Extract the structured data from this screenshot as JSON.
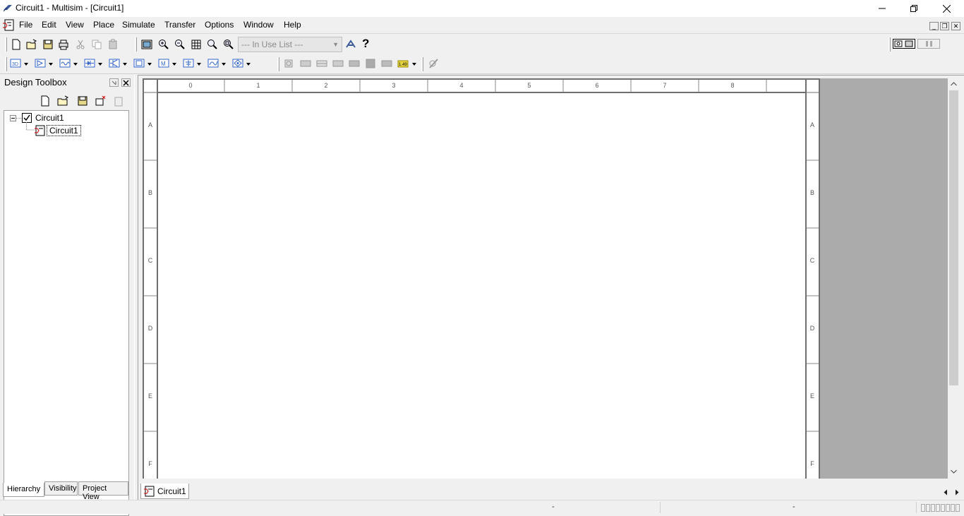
{
  "window": {
    "title": "Circuit1 - Multisim - [Circuit1]",
    "minimize_label": "—",
    "restore_label": "❐",
    "close_label": "✕"
  },
  "menubar": {
    "items": [
      "File",
      "Edit",
      "View",
      "Place",
      "Simulate",
      "Transfer",
      "Options",
      "Window",
      "Help"
    ]
  },
  "toolbar": {
    "in_use_list": "--- In Use List ---",
    "help_label": "?"
  },
  "toolbox": {
    "title": "Design Toolbox",
    "tree": {
      "root": "Circuit1",
      "child": "Circuit1"
    },
    "tabs": [
      "Hierarchy",
      "Visibility",
      "Project View"
    ]
  },
  "sheet": {
    "columns": [
      "0",
      "1",
      "2",
      "3",
      "4",
      "5",
      "6",
      "7",
      "8"
    ],
    "rows": [
      "A",
      "B",
      "C",
      "D",
      "E",
      "F"
    ]
  },
  "doc_tab": {
    "label": "Circuit1"
  },
  "statusbar": {
    "seg1": "-",
    "seg2": "-"
  }
}
